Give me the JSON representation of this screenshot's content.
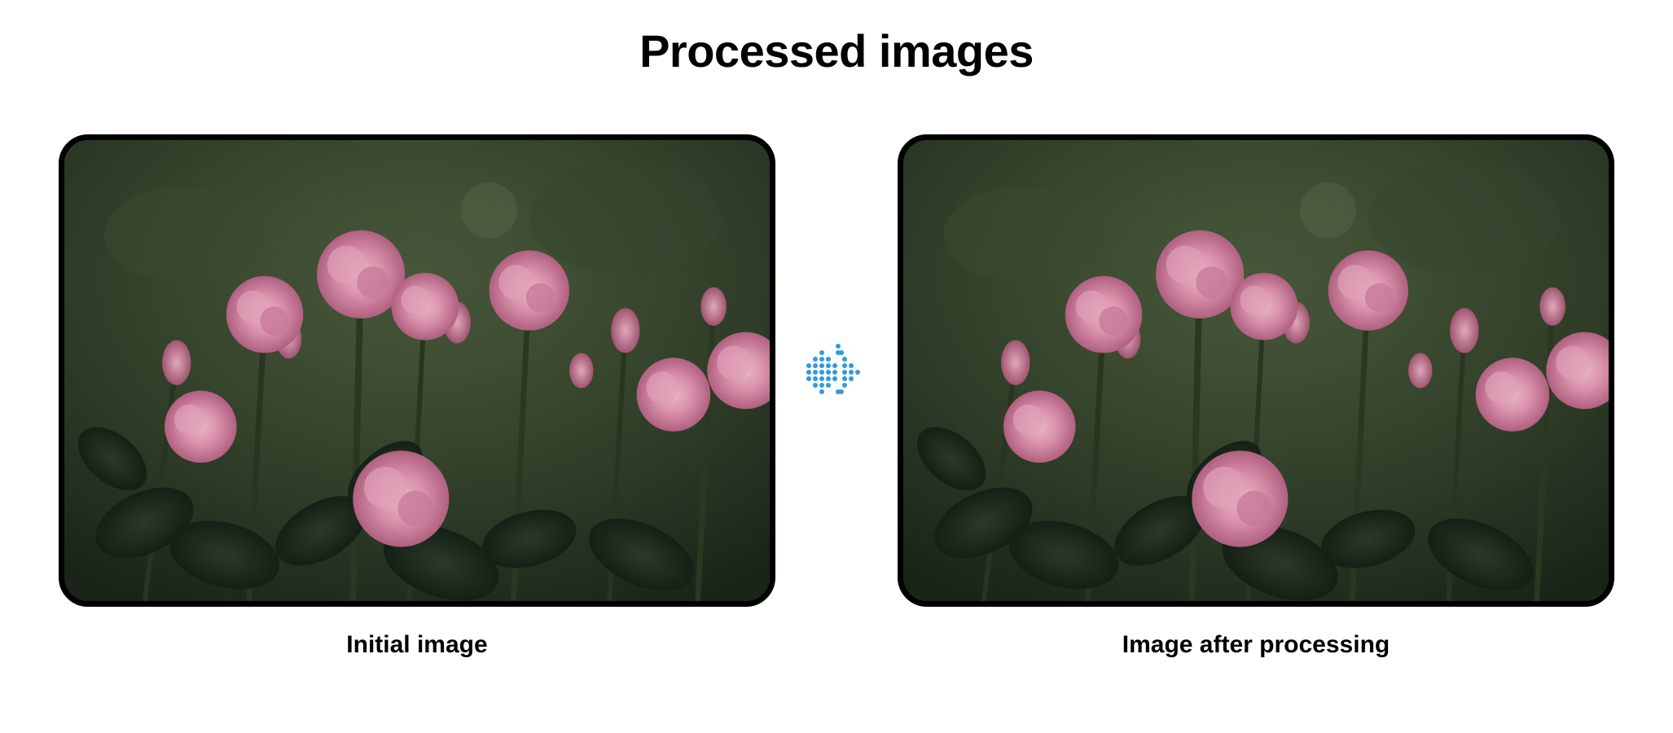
{
  "header": {
    "title": "Processed images"
  },
  "comparison": {
    "initial": {
      "label": "Initial image",
      "icon_name": "flower-image"
    },
    "processed": {
      "label": "Image after processing",
      "icon_name": "flower-image"
    },
    "arrow_icon": "dotted-arrow-right-icon"
  },
  "colors": {
    "accent": "#3399dd",
    "frame_border": "#000000",
    "background": "#ffffff"
  }
}
